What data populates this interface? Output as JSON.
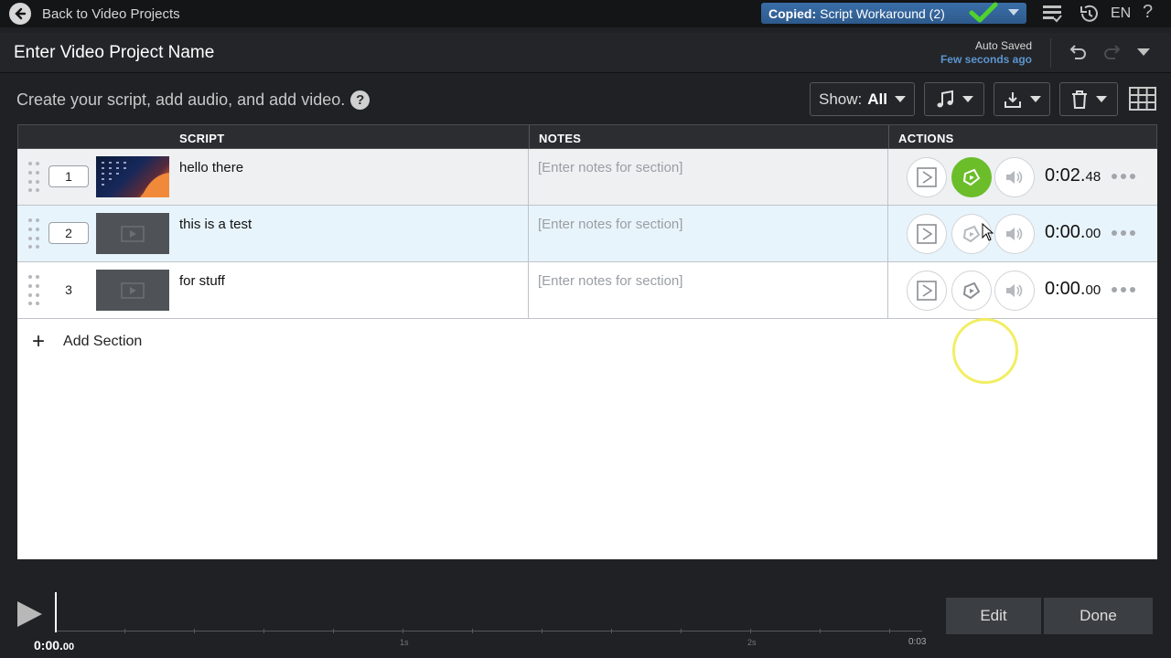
{
  "topbar": {
    "back_label": "Back to Video Projects",
    "copied_prefix": "Copied:",
    "copied_name": "Script Workaround (2)",
    "language": "EN",
    "help": "?"
  },
  "title": {
    "project_name": "Enter Video Project Name",
    "autosave_title": "Auto Saved",
    "autosave_time": "Few seconds ago"
  },
  "toolbar": {
    "hint": "Create your script, add audio, and add video.",
    "help": "?",
    "show_label": "Show:",
    "show_value": "All"
  },
  "table": {
    "headers": {
      "script": "SCRIPT",
      "notes": "NOTES",
      "actions": "ACTIONS"
    },
    "rows": [
      {
        "number": "1",
        "script": "hello there",
        "notes": "[Enter notes for section]",
        "duration_main": "0:02.",
        "duration_frac": "48",
        "has_video": true
      },
      {
        "number": "2",
        "script": "this is a test",
        "notes": "[Enter notes for section]",
        "duration_main": "0:00.",
        "duration_frac": "00",
        "has_video": false
      },
      {
        "number": "3",
        "script": "for stuff",
        "notes": "[Enter notes for section]",
        "duration_main": "0:00.",
        "duration_frac": "00",
        "has_video": false
      }
    ],
    "add_section_label": "Add Section"
  },
  "timeline": {
    "current_main": "0:00.",
    "current_frac": "00",
    "end_label": "0:03",
    "markers": [
      "1s",
      "2s"
    ]
  },
  "footer": {
    "edit_label": "Edit",
    "done_label": "Done"
  },
  "colors": {
    "accent_green": "#6bbd2a",
    "copied_blue": "#3a6ea8",
    "autosave_blue": "#5d95d0",
    "highlight_row": "#e8f4fc",
    "gray_row": "#eef0f2"
  }
}
